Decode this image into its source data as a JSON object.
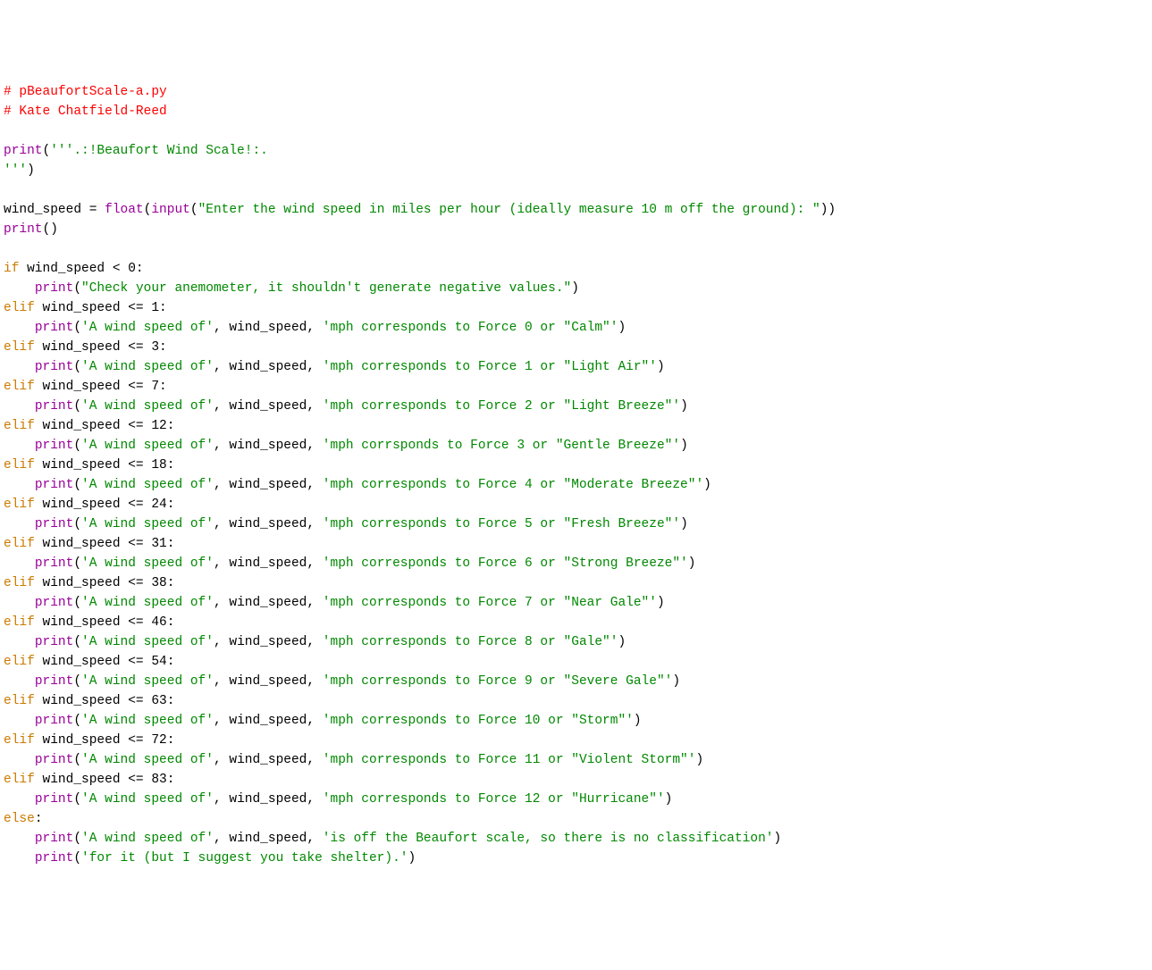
{
  "lines": [
    [
      {
        "cls": "c-comment",
        "t": "# pBeaufortScale-a.py"
      }
    ],
    [
      {
        "cls": "c-comment",
        "t": "# Kate Chatfield-Reed"
      }
    ],
    [],
    [
      {
        "cls": "c-builtin",
        "t": "print"
      },
      {
        "cls": "c-paren",
        "t": "("
      },
      {
        "cls": "c-string",
        "t": "'''.:!Beaufort Wind Scale!:."
      }
    ],
    [
      {
        "cls": "c-string",
        "t": "'''"
      },
      {
        "cls": "c-paren",
        "t": ")"
      }
    ],
    [],
    [
      {
        "cls": "c-black",
        "t": "wind_speed = "
      },
      {
        "cls": "c-builtin",
        "t": "float"
      },
      {
        "cls": "c-paren",
        "t": "("
      },
      {
        "cls": "c-builtin",
        "t": "input"
      },
      {
        "cls": "c-paren",
        "t": "("
      },
      {
        "cls": "c-string",
        "t": "\"Enter the wind speed in miles per hour (ideally measure 10 m off the ground): \""
      },
      {
        "cls": "c-paren",
        "t": "))"
      }
    ],
    [
      {
        "cls": "c-builtin",
        "t": "print"
      },
      {
        "cls": "c-paren",
        "t": "()"
      }
    ],
    [],
    [
      {
        "cls": "c-keyword",
        "t": "if"
      },
      {
        "cls": "c-black",
        "t": " wind_speed < 0:"
      }
    ],
    [
      {
        "cls": "c-black",
        "t": "    "
      },
      {
        "cls": "c-builtin",
        "t": "print"
      },
      {
        "cls": "c-paren",
        "t": "("
      },
      {
        "cls": "c-string",
        "t": "\"Check your anemometer, it shouldn't generate negative values.\""
      },
      {
        "cls": "c-paren",
        "t": ")"
      }
    ],
    [
      {
        "cls": "c-keyword",
        "t": "elif"
      },
      {
        "cls": "c-black",
        "t": " wind_speed <= 1:"
      }
    ],
    [
      {
        "cls": "c-black",
        "t": "    "
      },
      {
        "cls": "c-builtin",
        "t": "print"
      },
      {
        "cls": "c-paren",
        "t": "("
      },
      {
        "cls": "c-string",
        "t": "'A wind speed of'"
      },
      {
        "cls": "c-black",
        "t": ", wind_speed, "
      },
      {
        "cls": "c-string",
        "t": "'mph corresponds to Force 0 or \"Calm\"'"
      },
      {
        "cls": "c-paren",
        "t": ")"
      }
    ],
    [
      {
        "cls": "c-keyword",
        "t": "elif"
      },
      {
        "cls": "c-black",
        "t": " wind_speed <= 3:"
      }
    ],
    [
      {
        "cls": "c-black",
        "t": "    "
      },
      {
        "cls": "c-builtin",
        "t": "print"
      },
      {
        "cls": "c-paren",
        "t": "("
      },
      {
        "cls": "c-string",
        "t": "'A wind speed of'"
      },
      {
        "cls": "c-black",
        "t": ", wind_speed, "
      },
      {
        "cls": "c-string",
        "t": "'mph corresponds to Force 1 or \"Light Air\"'"
      },
      {
        "cls": "c-paren",
        "t": ")"
      }
    ],
    [
      {
        "cls": "c-keyword",
        "t": "elif"
      },
      {
        "cls": "c-black",
        "t": " wind_speed <= 7:"
      }
    ],
    [
      {
        "cls": "c-black",
        "t": "    "
      },
      {
        "cls": "c-builtin",
        "t": "print"
      },
      {
        "cls": "c-paren",
        "t": "("
      },
      {
        "cls": "c-string",
        "t": "'A wind speed of'"
      },
      {
        "cls": "c-black",
        "t": ", wind_speed, "
      },
      {
        "cls": "c-string",
        "t": "'mph corresponds to Force 2 or \"Light Breeze\"'"
      },
      {
        "cls": "c-paren",
        "t": ")"
      }
    ],
    [
      {
        "cls": "c-keyword",
        "t": "elif"
      },
      {
        "cls": "c-black",
        "t": " wind_speed <= 12:"
      }
    ],
    [
      {
        "cls": "c-black",
        "t": "    "
      },
      {
        "cls": "c-builtin",
        "t": "print"
      },
      {
        "cls": "c-paren",
        "t": "("
      },
      {
        "cls": "c-string",
        "t": "'A wind speed of'"
      },
      {
        "cls": "c-black",
        "t": ", wind_speed, "
      },
      {
        "cls": "c-string",
        "t": "'mph corrsponds to Force 3 or \"Gentle Breeze\"'"
      },
      {
        "cls": "c-paren",
        "t": ")"
      }
    ],
    [
      {
        "cls": "c-keyword",
        "t": "elif"
      },
      {
        "cls": "c-black",
        "t": " wind_speed <= 18:"
      }
    ],
    [
      {
        "cls": "c-black",
        "t": "    "
      },
      {
        "cls": "c-builtin",
        "t": "print"
      },
      {
        "cls": "c-paren",
        "t": "("
      },
      {
        "cls": "c-string",
        "t": "'A wind speed of'"
      },
      {
        "cls": "c-black",
        "t": ", wind_speed, "
      },
      {
        "cls": "c-string",
        "t": "'mph corresponds to Force 4 or \"Moderate Breeze\"'"
      },
      {
        "cls": "c-paren",
        "t": ")"
      }
    ],
    [
      {
        "cls": "c-keyword",
        "t": "elif"
      },
      {
        "cls": "c-black",
        "t": " wind_speed <= 24:"
      }
    ],
    [
      {
        "cls": "c-black",
        "t": "    "
      },
      {
        "cls": "c-builtin",
        "t": "print"
      },
      {
        "cls": "c-paren",
        "t": "("
      },
      {
        "cls": "c-string",
        "t": "'A wind speed of'"
      },
      {
        "cls": "c-black",
        "t": ", wind_speed, "
      },
      {
        "cls": "c-string",
        "t": "'mph corresponds to Force 5 or \"Fresh Breeze\"'"
      },
      {
        "cls": "c-paren",
        "t": ")"
      }
    ],
    [
      {
        "cls": "c-keyword",
        "t": "elif"
      },
      {
        "cls": "c-black",
        "t": " wind_speed <= 31:"
      }
    ],
    [
      {
        "cls": "c-black",
        "t": "    "
      },
      {
        "cls": "c-builtin",
        "t": "print"
      },
      {
        "cls": "c-paren",
        "t": "("
      },
      {
        "cls": "c-string",
        "t": "'A wind speed of'"
      },
      {
        "cls": "c-black",
        "t": ", wind_speed, "
      },
      {
        "cls": "c-string",
        "t": "'mph corresponds to Force 6 or \"Strong Breeze\"'"
      },
      {
        "cls": "c-paren",
        "t": ")"
      }
    ],
    [
      {
        "cls": "c-keyword",
        "t": "elif"
      },
      {
        "cls": "c-black",
        "t": " wind_speed <= 38:"
      }
    ],
    [
      {
        "cls": "c-black",
        "t": "    "
      },
      {
        "cls": "c-builtin",
        "t": "print"
      },
      {
        "cls": "c-paren",
        "t": "("
      },
      {
        "cls": "c-string",
        "t": "'A wind speed of'"
      },
      {
        "cls": "c-black",
        "t": ", wind_speed, "
      },
      {
        "cls": "c-string",
        "t": "'mph corresponds to Force 7 or \"Near Gale\"'"
      },
      {
        "cls": "c-paren",
        "t": ")"
      }
    ],
    [
      {
        "cls": "c-keyword",
        "t": "elif"
      },
      {
        "cls": "c-black",
        "t": " wind_speed <= 46:"
      }
    ],
    [
      {
        "cls": "c-black",
        "t": "    "
      },
      {
        "cls": "c-builtin",
        "t": "print"
      },
      {
        "cls": "c-paren",
        "t": "("
      },
      {
        "cls": "c-string",
        "t": "'A wind speed of'"
      },
      {
        "cls": "c-black",
        "t": ", wind_speed, "
      },
      {
        "cls": "c-string",
        "t": "'mph corresponds to Force 8 or \"Gale\"'"
      },
      {
        "cls": "c-paren",
        "t": ")"
      }
    ],
    [
      {
        "cls": "c-keyword",
        "t": "elif"
      },
      {
        "cls": "c-black",
        "t": " wind_speed <= 54:"
      }
    ],
    [
      {
        "cls": "c-black",
        "t": "    "
      },
      {
        "cls": "c-builtin",
        "t": "print"
      },
      {
        "cls": "c-paren",
        "t": "("
      },
      {
        "cls": "c-string",
        "t": "'A wind speed of'"
      },
      {
        "cls": "c-black",
        "t": ", wind_speed, "
      },
      {
        "cls": "c-string",
        "t": "'mph corresponds to Force 9 or \"Severe Gale\"'"
      },
      {
        "cls": "c-paren",
        "t": ")"
      }
    ],
    [
      {
        "cls": "c-keyword",
        "t": "elif"
      },
      {
        "cls": "c-black",
        "t": " wind_speed <= 63:"
      }
    ],
    [
      {
        "cls": "c-black",
        "t": "    "
      },
      {
        "cls": "c-builtin",
        "t": "print"
      },
      {
        "cls": "c-paren",
        "t": "("
      },
      {
        "cls": "c-string",
        "t": "'A wind speed of'"
      },
      {
        "cls": "c-black",
        "t": ", wind_speed, "
      },
      {
        "cls": "c-string",
        "t": "'mph corresponds to Force 10 or \"Storm\"'"
      },
      {
        "cls": "c-paren",
        "t": ")"
      }
    ],
    [
      {
        "cls": "c-keyword",
        "t": "elif"
      },
      {
        "cls": "c-black",
        "t": " wind_speed <= 72:"
      }
    ],
    [
      {
        "cls": "c-black",
        "t": "    "
      },
      {
        "cls": "c-builtin",
        "t": "print"
      },
      {
        "cls": "c-paren",
        "t": "("
      },
      {
        "cls": "c-string",
        "t": "'A wind speed of'"
      },
      {
        "cls": "c-black",
        "t": ", wind_speed, "
      },
      {
        "cls": "c-string",
        "t": "'mph corresponds to Force 11 or \"Violent Storm\"'"
      },
      {
        "cls": "c-paren",
        "t": ")"
      }
    ],
    [
      {
        "cls": "c-keyword",
        "t": "elif"
      },
      {
        "cls": "c-black",
        "t": " wind_speed <= 83:"
      }
    ],
    [
      {
        "cls": "c-black",
        "t": "    "
      },
      {
        "cls": "c-builtin",
        "t": "print"
      },
      {
        "cls": "c-paren",
        "t": "("
      },
      {
        "cls": "c-string",
        "t": "'A wind speed of'"
      },
      {
        "cls": "c-black",
        "t": ", wind_speed, "
      },
      {
        "cls": "c-string",
        "t": "'mph corresponds to Force 12 or \"Hurricane\"'"
      },
      {
        "cls": "c-paren",
        "t": ")"
      }
    ],
    [
      {
        "cls": "c-keyword",
        "t": "else"
      },
      {
        "cls": "c-black",
        "t": ":"
      }
    ],
    [
      {
        "cls": "c-black",
        "t": "    "
      },
      {
        "cls": "c-builtin",
        "t": "print"
      },
      {
        "cls": "c-paren",
        "t": "("
      },
      {
        "cls": "c-string",
        "t": "'A wind speed of'"
      },
      {
        "cls": "c-black",
        "t": ", wind_speed, "
      },
      {
        "cls": "c-string",
        "t": "'is off the Beaufort scale, so there is no classification'"
      },
      {
        "cls": "c-paren",
        "t": ")"
      }
    ],
    [
      {
        "cls": "c-black",
        "t": "    "
      },
      {
        "cls": "c-builtin",
        "t": "print"
      },
      {
        "cls": "c-paren",
        "t": "("
      },
      {
        "cls": "c-string",
        "t": "'for it (but I suggest you take shelter).'"
      },
      {
        "cls": "c-paren",
        "t": ")"
      }
    ]
  ]
}
